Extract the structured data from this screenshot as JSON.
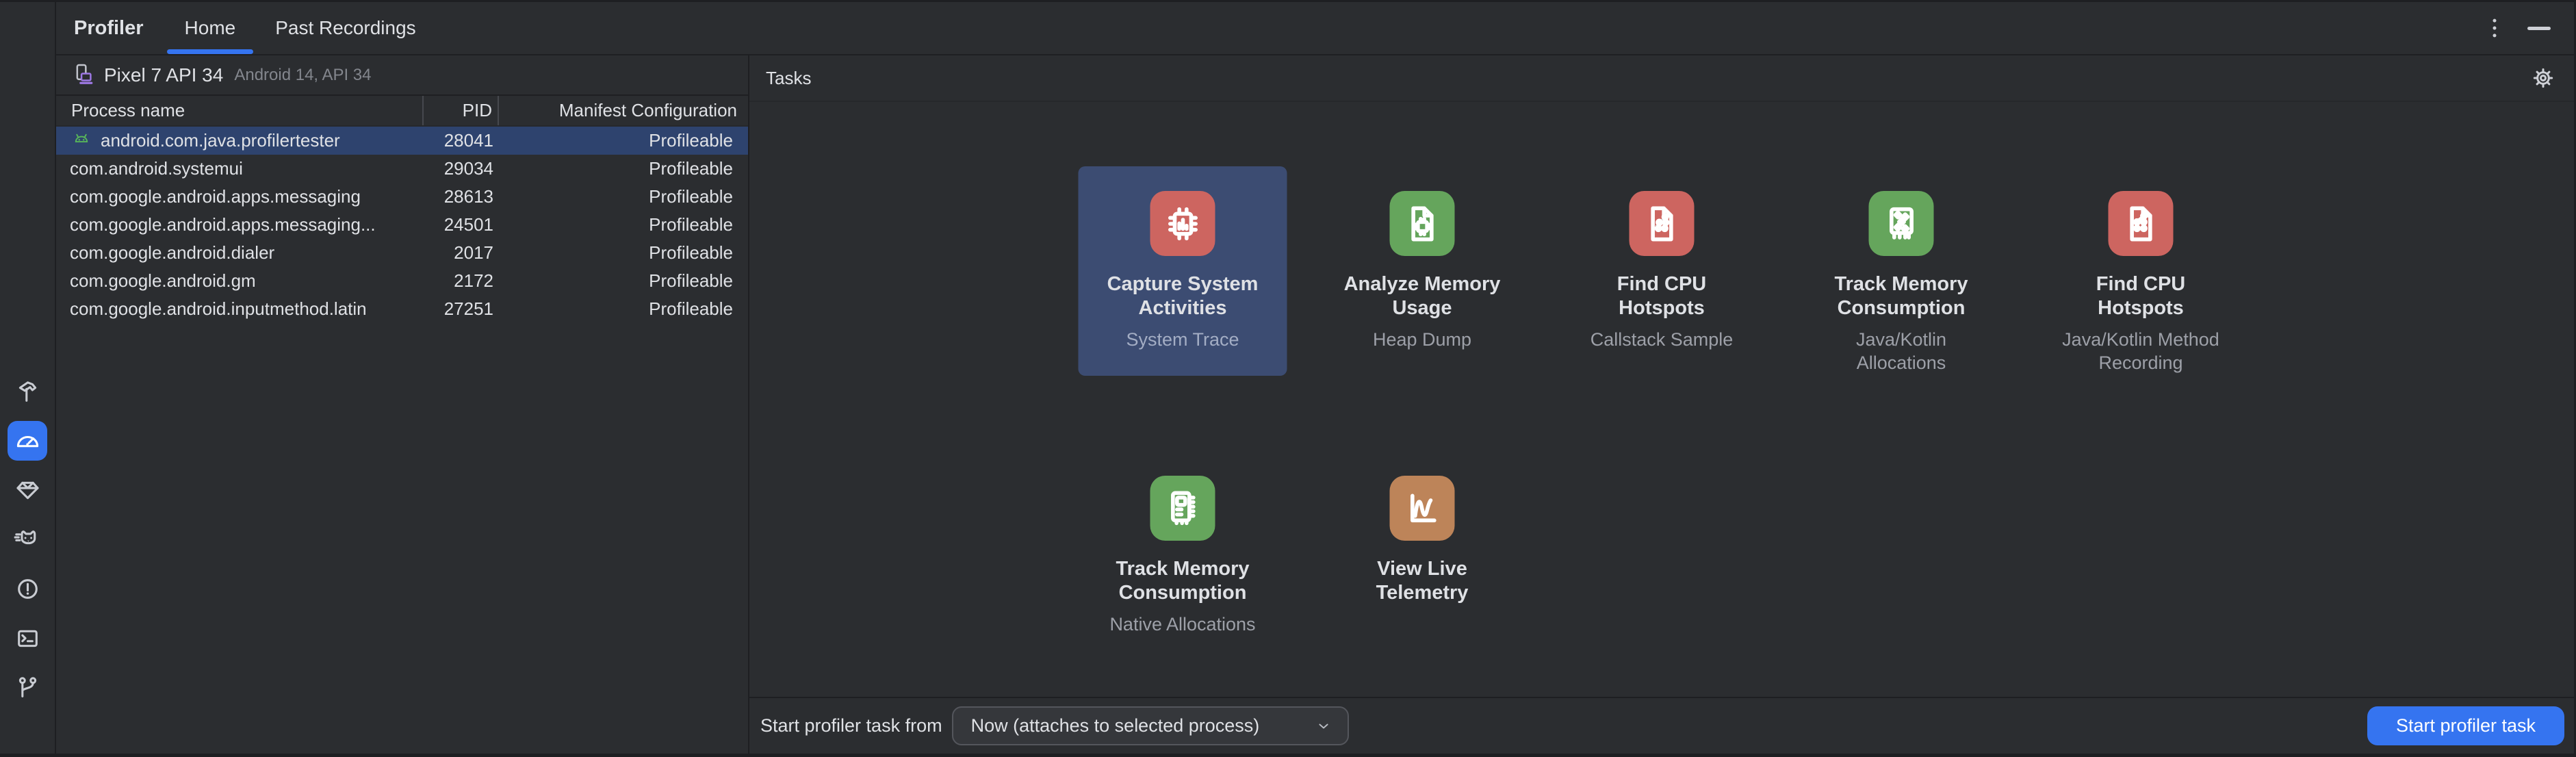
{
  "tab_bar": {
    "title": "Profiler",
    "tabs": [
      {
        "id": "home",
        "label": "Home",
        "selected": true
      },
      {
        "id": "past-recordings",
        "label": "Past Recordings",
        "selected": false
      }
    ]
  },
  "sidebar": {
    "items": [
      {
        "id": "build",
        "icon": "hammer"
      },
      {
        "id": "profiler",
        "icon": "gauge",
        "selected": true
      },
      {
        "id": "app-quality-insights",
        "icon": "gem"
      },
      {
        "id": "logcat",
        "icon": "cat"
      },
      {
        "id": "problems",
        "icon": "alert-circle"
      },
      {
        "id": "terminal",
        "icon": "terminal"
      },
      {
        "id": "version-control",
        "icon": "git-branch"
      }
    ]
  },
  "device_bar": {
    "name": "Pixel 7 API 34",
    "details": "Android 14, API 34"
  },
  "process_table": {
    "columns": [
      {
        "label": "Process name"
      },
      {
        "label": "PID"
      },
      {
        "label": "Manifest Configuration"
      }
    ],
    "rows": [
      {
        "id": "profilertester",
        "icon": "android-robot",
        "name": "android.com.java.profilertester",
        "pid": "28041",
        "manifest": "Profileable",
        "selected": true
      },
      {
        "id": "systemui",
        "name": "com.android.systemui",
        "pid": "29034",
        "manifest": "Profileable"
      },
      {
        "id": "messaging",
        "name": "com.google.android.apps.messaging",
        "pid": "28613",
        "manifest": "Profileable"
      },
      {
        "id": "messaging-2",
        "name": "com.google.android.apps.messaging...",
        "pid": "24501",
        "manifest": "Profileable"
      },
      {
        "id": "dialer",
        "name": "com.google.android.dialer",
        "pid": "2017",
        "manifest": "Profileable"
      },
      {
        "id": "gm",
        "name": "com.google.android.gm",
        "pid": "2172",
        "manifest": "Profileable"
      },
      {
        "id": "inputmethod-latin",
        "name": "com.google.android.inputmethod.latin",
        "pid": "27251",
        "manifest": "Profileable"
      }
    ]
  },
  "tasks": {
    "title": "Tasks",
    "cards": [
      {
        "id": "system-trace",
        "title": "Capture System Activities",
        "subtitle": "System Trace",
        "icon": "chip-trace",
        "color": "#cd6560",
        "selected": true
      },
      {
        "id": "heap-dump",
        "title": "Analyze Memory Usage",
        "subtitle": "Heap Dump",
        "icon": "doc-chip",
        "color": "#65a55c"
      },
      {
        "id": "callstack-sample",
        "title": "Find CPU Hotspots",
        "subtitle": "Callstack Sample",
        "icon": "doc-dots",
        "color": "#cd6560"
      },
      {
        "id": "java-kotlin-allocations",
        "title": "Track Memory Consumption",
        "subtitle": "Java/Kotlin Allocations",
        "icon": "ram-diamonds",
        "color": "#65a55c"
      },
      {
        "id": "method-recording",
        "title": "Find CPU Hotspots",
        "subtitle": "Java/Kotlin Method Recording",
        "icon": "doc-nodes",
        "color": "#cd6560"
      },
      {
        "id": "native-allocations",
        "title": "Track Memory Consumption",
        "subtitle": "Native Allocations",
        "icon": "ram-stick",
        "color": "#65a55c"
      },
      {
        "id": "live-telemetry",
        "title": "View Live Telemetry",
        "subtitle": "",
        "icon": "chart-live",
        "color": "#bd8459"
      }
    ]
  },
  "footer": {
    "label": "Start profiler task from",
    "dropdown_value": "Now (attaches to selected process)",
    "button": "Start profiler task"
  },
  "colors": {
    "panel_bg": "#2b2d30",
    "border": "#1e1f22",
    "accent_blue": "#3574f0",
    "row_selection": "#2e436e",
    "card_selection": "#3c4c72",
    "task_red": "#cd6560",
    "task_green": "#65a55c",
    "task_orange": "#bd8459",
    "device_purple": "#9d78e3",
    "robot_green": "#57b55a",
    "text_primary": "#dfe1e5",
    "text_secondary": "#9da0a8"
  }
}
